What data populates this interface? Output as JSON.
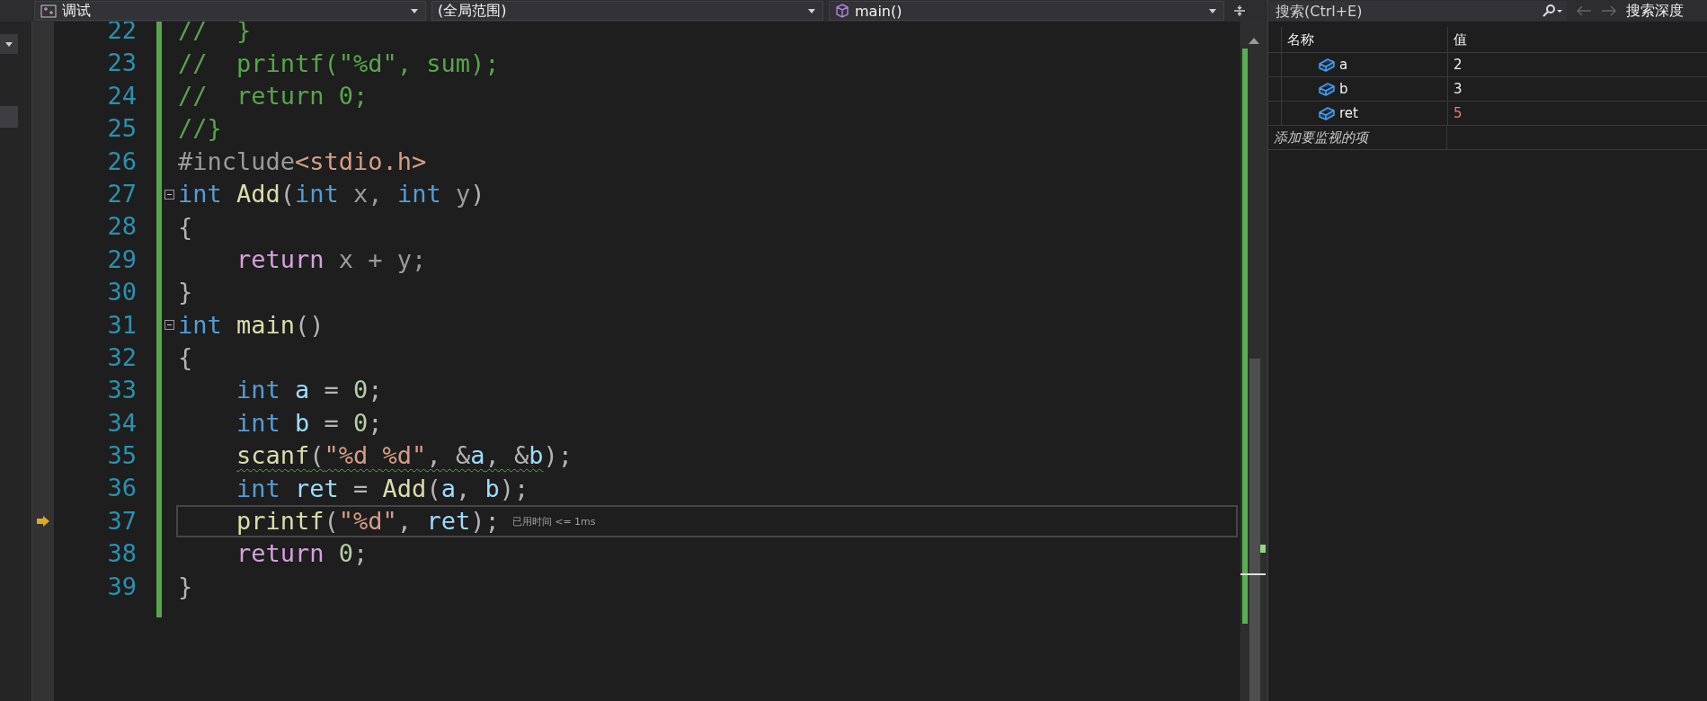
{
  "toolbar": {
    "dropdowns": [
      {
        "kind": "project",
        "label": "调试"
      },
      {
        "kind": "scope",
        "label": "(全局范围)"
      },
      {
        "kind": "member",
        "label": "main()"
      }
    ]
  },
  "editor": {
    "lines": [
      {
        "number": "22",
        "current": false,
        "fold": false,
        "warning": false,
        "tokens": [
          {
            "text": "//  }",
            "kind": "comment"
          }
        ]
      },
      {
        "number": "23",
        "current": false,
        "fold": false,
        "warning": false,
        "tokens": [
          {
            "text": "//  printf(\"%d\", sum);",
            "kind": "comment"
          }
        ]
      },
      {
        "number": "24",
        "current": false,
        "fold": false,
        "warning": false,
        "tokens": [
          {
            "text": "//  return 0;",
            "kind": "comment"
          }
        ]
      },
      {
        "number": "25",
        "current": false,
        "fold": false,
        "warning": false,
        "tokens": [
          {
            "text": "//}",
            "kind": "comment"
          }
        ]
      },
      {
        "number": "26",
        "current": false,
        "fold": false,
        "warning": false,
        "tokens": [
          {
            "text": "#include",
            "kind": "preproc"
          },
          {
            "text": "<stdio.h>",
            "kind": "string"
          }
        ]
      },
      {
        "number": "27",
        "current": false,
        "fold": true,
        "warning": false,
        "tokens": [
          {
            "text": "int",
            "kind": "keyword"
          },
          {
            "text": " Add",
            "kind": "function"
          },
          {
            "text": "(",
            "kind": "punct"
          },
          {
            "text": "int",
            "kind": "keyword"
          },
          {
            "text": " x, ",
            "kind": "param"
          },
          {
            "text": "int",
            "kind": "keyword"
          },
          {
            "text": " y",
            "kind": "param"
          },
          {
            "text": ")",
            "kind": "punct"
          }
        ]
      },
      {
        "number": "28",
        "current": false,
        "fold": false,
        "warning": false,
        "tokens": [
          {
            "text": "{",
            "kind": "punct"
          }
        ]
      },
      {
        "number": "29",
        "current": false,
        "fold": false,
        "warning": false,
        "tokens": [
          {
            "text": "    return",
            "kind": "control"
          },
          {
            "text": " x + y;",
            "kind": "param"
          }
        ]
      },
      {
        "number": "30",
        "current": false,
        "fold": false,
        "warning": false,
        "tokens": [
          {
            "text": "}",
            "kind": "punct"
          }
        ]
      },
      {
        "number": "31",
        "current": false,
        "fold": true,
        "warning": false,
        "tokens": [
          {
            "text": "int",
            "kind": "keyword"
          },
          {
            "text": " main",
            "kind": "function"
          },
          {
            "text": "()",
            "kind": "punct"
          }
        ]
      },
      {
        "number": "32",
        "current": false,
        "fold": false,
        "warning": false,
        "tokens": [
          {
            "text": "{",
            "kind": "punct"
          }
        ]
      },
      {
        "number": "33",
        "current": false,
        "fold": false,
        "warning": false,
        "tokens": [
          {
            "text": "    int",
            "kind": "keyword"
          },
          {
            "text": " a",
            "kind": "variable"
          },
          {
            "text": " = ",
            "kind": "punct"
          },
          {
            "text": "0",
            "kind": "number"
          },
          {
            "text": ";",
            "kind": "punct"
          }
        ]
      },
      {
        "number": "34",
        "current": false,
        "fold": false,
        "warning": false,
        "tokens": [
          {
            "text": "    int",
            "kind": "keyword"
          },
          {
            "text": " b",
            "kind": "variable"
          },
          {
            "text": " = ",
            "kind": "punct"
          },
          {
            "text": "0",
            "kind": "number"
          },
          {
            "text": ";",
            "kind": "punct"
          }
        ]
      },
      {
        "number": "35",
        "current": false,
        "fold": false,
        "warning": true,
        "tokens": [
          {
            "text": "    scanf",
            "kind": "function"
          },
          {
            "text": "(",
            "kind": "punct"
          },
          {
            "text": "\"%d %d\"",
            "kind": "string"
          },
          {
            "text": ", &",
            "kind": "punct"
          },
          {
            "text": "a",
            "kind": "variable"
          },
          {
            "text": ", &",
            "kind": "punct"
          },
          {
            "text": "b",
            "kind": "variable"
          },
          {
            "text": ");",
            "kind": "punct"
          }
        ]
      },
      {
        "number": "36",
        "current": false,
        "fold": false,
        "warning": false,
        "tokens": [
          {
            "text": "    int",
            "kind": "keyword"
          },
          {
            "text": " ret",
            "kind": "variable"
          },
          {
            "text": " = ",
            "kind": "punct"
          },
          {
            "text": "Add",
            "kind": "function"
          },
          {
            "text": "(",
            "kind": "punct"
          },
          {
            "text": "a",
            "kind": "variable"
          },
          {
            "text": ", ",
            "kind": "punct"
          },
          {
            "text": "b",
            "kind": "variable"
          },
          {
            "text": ");",
            "kind": "punct"
          }
        ]
      },
      {
        "number": "37",
        "current": true,
        "fold": false,
        "warning": false,
        "hint": "已用时间 <= 1ms",
        "tokens": [
          {
            "text": "    printf",
            "kind": "function"
          },
          {
            "text": "(",
            "kind": "punct"
          },
          {
            "text": "\"%d\"",
            "kind": "string"
          },
          {
            "text": ", ",
            "kind": "punct"
          },
          {
            "text": "ret",
            "kind": "variable"
          },
          {
            "text": ");",
            "kind": "punct"
          }
        ]
      },
      {
        "number": "38",
        "current": false,
        "fold": false,
        "warning": false,
        "tokens": [
          {
            "text": "    return",
            "kind": "control"
          },
          {
            "text": " 0",
            "kind": "number"
          },
          {
            "text": ";",
            "kind": "punct"
          }
        ]
      },
      {
        "number": "39",
        "current": false,
        "fold": false,
        "warning": false,
        "tokens": [
          {
            "text": "}",
            "kind": "punct"
          }
        ]
      }
    ]
  },
  "watch": {
    "search": {
      "placeholder": "搜索(Ctrl+E)"
    },
    "search_depth_label": "搜索深度",
    "columns": [
      "名称",
      "值"
    ],
    "rows": [
      {
        "name": "a",
        "value": "2",
        "changed": false
      },
      {
        "name": "b",
        "value": "3",
        "changed": false
      },
      {
        "name": "ret",
        "value": "5",
        "changed": true
      }
    ],
    "add_placeholder": "添加要监视的项"
  }
}
